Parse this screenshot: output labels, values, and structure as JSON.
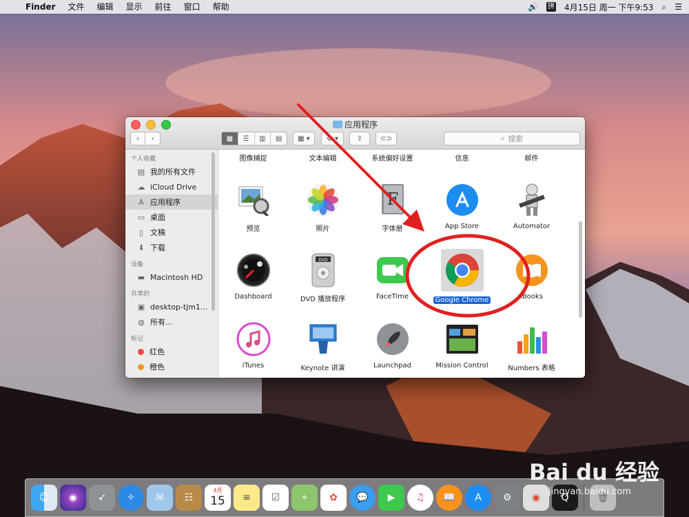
{
  "menubar": {
    "app_name": "Finder",
    "items": [
      "文件",
      "编辑",
      "显示",
      "前往",
      "窗口",
      "帮助"
    ],
    "ime_label": "拼",
    "clock": "4月15日 周一 下午9:53"
  },
  "window": {
    "title": "应用程序",
    "search_placeholder": "搜索"
  },
  "sidebar": {
    "sections": [
      {
        "header": "个人收藏",
        "items": [
          "我的所有文件",
          "iCloud Drive",
          "应用程序",
          "桌面",
          "文稿",
          "下载"
        ]
      },
      {
        "header": "设备",
        "items": [
          "Macintosh HD"
        ]
      },
      {
        "header": "共享的",
        "items": [
          "desktop-tjm1...",
          "所有..."
        ]
      },
      {
        "header": "标记",
        "items": [
          "红色",
          "橙色"
        ]
      }
    ],
    "selected": "应用程序"
  },
  "content": {
    "top_row_labels": [
      "图像捕捉",
      "文本编辑",
      "系统偏好设置",
      "信息",
      "邮件"
    ],
    "rows": [
      [
        "预览",
        "照片",
        "字体册",
        "App Store",
        "Automator"
      ],
      [
        "Dashboard",
        "DVD 播放程序",
        "FaceTime",
        "Google Chrome",
        "iBooks"
      ],
      [
        "iTunes",
        "Keynote 讲演",
        "Launchpad",
        "Mission Control",
        "Numbers 表格"
      ]
    ],
    "selected_app": "Google Chrome"
  },
  "dock": {
    "apps": [
      "Finder",
      "Siri",
      "Launchpad",
      "Safari",
      "Mail",
      "Contacts",
      "Calendar",
      "Notes",
      "Reminders",
      "Maps",
      "Photos",
      "Messages",
      "FaceTime",
      "iTunes",
      "iBooks",
      "App Store",
      "System Preferences",
      "Chrome",
      "QuickTime",
      "Trash"
    ],
    "calendar_month": "4月",
    "calendar_day": "15"
  },
  "watermark": {
    "brand": "Bai du 经验",
    "url": "jingyan.baidu.com"
  },
  "colors": {
    "selection_blue": "#1b64d4",
    "annotation_red": "#e02020"
  }
}
